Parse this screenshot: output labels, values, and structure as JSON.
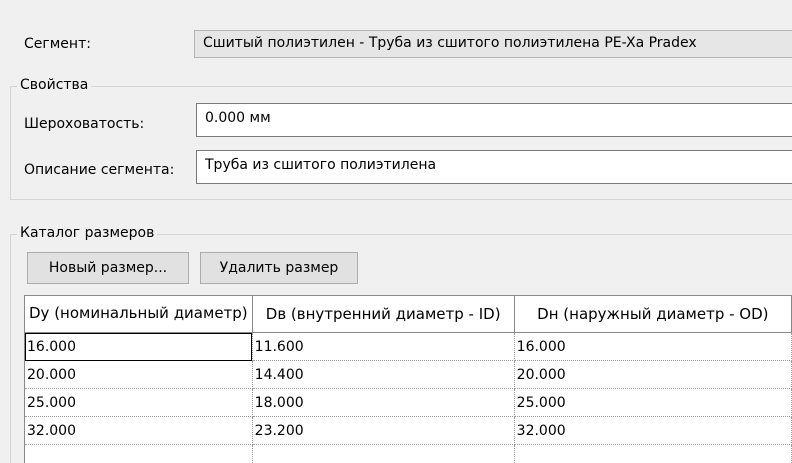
{
  "segment": {
    "label": "Сегмент:",
    "value": "Сшитый полиэтилен - Труба из сшитого полиэтилена PE-Xa Pradex"
  },
  "properties": {
    "title": "Свойства",
    "roughness_label": "Шероховатость:",
    "roughness_value": "0.000 мм",
    "description_label": "Описание сегмента:",
    "description_value": "Труба из сшитого полиэтилена"
  },
  "catalog": {
    "title": "Каталог размеров",
    "new_size_button": "Новый размер...",
    "delete_size_button": "Удалить размер",
    "columns": [
      "Dy (номинальный диаметр)",
      "Dв (внутренний диаметр - ID)",
      "Dн (наружный диаметр - OD)"
    ],
    "rows": [
      [
        "16.000",
        "11.600",
        "16.000"
      ],
      [
        "20.000",
        "14.400",
        "20.000"
      ],
      [
        "25.000",
        "18.000",
        "25.000"
      ],
      [
        "32.000",
        "23.200",
        "32.000"
      ],
      [
        "",
        "",
        ""
      ]
    ]
  }
}
